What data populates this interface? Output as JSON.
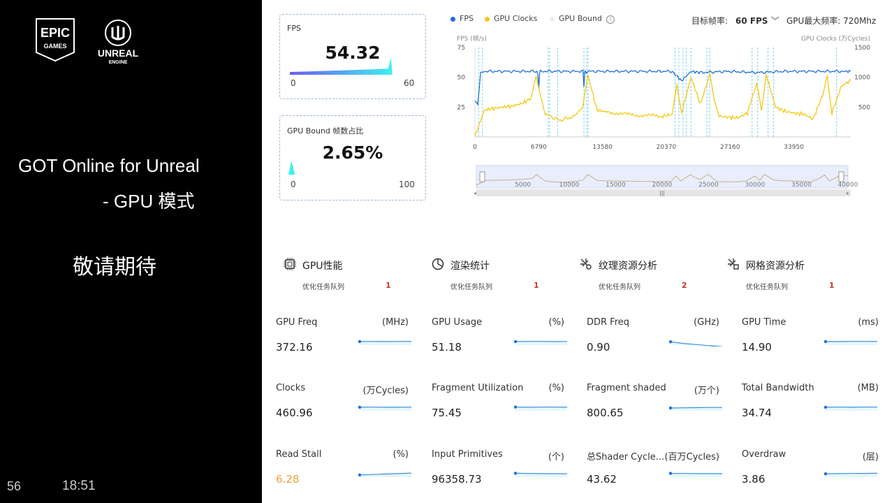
{
  "slide": {
    "title_line1": "GOT Online for Unreal",
    "title_line2": "- GPU 模式",
    "subtitle": "敬请期待",
    "slide_number": "56",
    "time": "18:51",
    "epic_logo_text": [
      "EPIC",
      "GAMES"
    ],
    "unreal_logo_text": [
      "UNREAL",
      "ENGINE"
    ]
  },
  "fps_card": {
    "label": "FPS",
    "value": "54.32",
    "min": "0",
    "max": "60",
    "fraction": 0.905
  },
  "gpu_bound_card": {
    "label": "GPU Bound 帧数占比",
    "value": "2.65%",
    "min": "0",
    "max": "100",
    "fraction": 0.0265
  },
  "chart_header": {
    "legend": [
      {
        "name": "FPS",
        "color": "#1f6fd6"
      },
      {
        "name": "GPU Clocks",
        "color": "#f2c811"
      },
      {
        "name": "GPU Bound",
        "color": "#eeeeee"
      }
    ],
    "info_icon": "info-circle-icon",
    "target_fps_label": "目标帧率:",
    "target_fps_value": "60 FPS",
    "max_freq_label": "GPU最大频率: 720Mhz"
  },
  "chart_data": {
    "type": "line",
    "y_left_label": "FPS (帧/s)",
    "y_right_label": "GPU Clocks (万Cycles)",
    "y_left_ticks": [
      "75",
      "50",
      "25"
    ],
    "y_right_ticks": [
      "1500",
      "1000",
      "500"
    ],
    "x_ticks": [
      "0",
      "6790",
      "13580",
      "20370",
      "27160",
      "33950"
    ],
    "ylim_left": [
      0,
      75
    ],
    "ylim_right": [
      0,
      1500
    ],
    "xlim": [
      0,
      40000
    ],
    "series": [
      {
        "name": "FPS",
        "color": "#1f6fd6",
        "axis": "left",
        "x": [
          0,
          300,
          600,
          900,
          1200,
          6600,
          6700,
          6800,
          6900,
          7000,
          11500,
          11600,
          11700,
          11800,
          11900,
          12000,
          21000,
          22000,
          23000,
          24000,
          27000,
          30000,
          33000,
          36000,
          39000,
          40000
        ],
        "y": [
          30,
          28,
          53,
          55,
          55,
          55,
          53,
          40,
          55,
          55,
          55,
          42,
          55,
          55,
          54,
          55,
          55,
          47,
          55,
          54,
          55,
          54,
          55,
          55,
          55,
          55
        ]
      },
      {
        "name": "GPU Clocks",
        "color": "#f2c811",
        "axis": "right",
        "x": [
          0,
          1000,
          2000,
          3000,
          4000,
          5000,
          6000,
          6500,
          7000,
          7500,
          9000,
          10500,
          11500,
          12000,
          13000,
          14000,
          16000,
          18000,
          20000,
          21000,
          21500,
          22000,
          23000,
          24000,
          25000,
          25500,
          26000,
          27000,
          28000,
          29000,
          30000,
          30500,
          31000,
          32000,
          33000,
          34000,
          35000,
          36000,
          37000,
          37500,
          38000,
          39000,
          40000
        ],
        "y": [
          0,
          450,
          480,
          500,
          520,
          560,
          650,
          1050,
          650,
          380,
          280,
          340,
          500,
          1050,
          450,
          420,
          380,
          360,
          350,
          380,
          900,
          400,
          1000,
          550,
          1050,
          600,
          350,
          330,
          320,
          400,
          900,
          450,
          1050,
          500,
          430,
          400,
          380,
          300,
          700,
          1000,
          400,
          850,
          950
        ]
      }
    ],
    "gpu_bound_x": [
      400,
      800,
      7800,
      7950,
      8800,
      11600,
      11900,
      12050,
      21300,
      21700,
      22150,
      22500,
      23000,
      24700,
      25000,
      29500,
      30100,
      31200,
      31800,
      38500
    ]
  },
  "slider": {
    "ticks": [
      "5000",
      "10000",
      "15000",
      "20000",
      "25000",
      "30000",
      "35000",
      "40000"
    ]
  },
  "categories": [
    {
      "name": "GPU性能",
      "icon": "gpu-chip-icon",
      "sub": "优化任务队列",
      "count": "1"
    },
    {
      "name": "渲染统计",
      "icon": "pie-chart-icon",
      "sub": "优化任务队列",
      "count": "1"
    },
    {
      "name": "纹理资源分析",
      "icon": "texture-analysis-icon",
      "sub": "优化任务队列",
      "count": "2"
    },
    {
      "name": "网格资源分析",
      "icon": "mesh-analysis-icon",
      "sub": "优化任务队列",
      "count": "1"
    }
  ],
  "metrics": [
    {
      "name": "GPU Freq",
      "unit": "(MHz)",
      "value": "372.16",
      "trend": [
        0.62,
        0.63,
        0.62,
        0.63,
        0.63
      ]
    },
    {
      "name": "GPU Usage",
      "unit": "(%)",
      "value": "51.18",
      "trend": [
        0.62,
        0.63,
        0.63,
        0.62,
        0.63
      ]
    },
    {
      "name": "DDR Freq",
      "unit": "(GHz)",
      "value": "0.90",
      "trend": [
        0.6,
        0.45,
        0.35,
        0.25,
        0.15
      ]
    },
    {
      "name": "GPU Time",
      "unit": "(ms)",
      "value": "14.90",
      "trend": [
        0.62,
        0.62,
        0.63,
        0.63,
        0.63
      ]
    },
    {
      "name": "Clocks",
      "unit": "(万Cycles)",
      "value": "460.96",
      "trend": [
        0.62,
        0.63,
        0.62,
        0.62,
        0.63
      ]
    },
    {
      "name": "Fragment Utilization",
      "unit": "(%)",
      "value": "75.45",
      "trend": [
        0.63,
        0.62,
        0.63,
        0.63,
        0.62
      ]
    },
    {
      "name": "Fragment shaded",
      "unit": "(万个)",
      "value": "800.65",
      "trend": [
        0.55,
        0.57,
        0.58,
        0.6,
        0.6
      ]
    },
    {
      "name": "Total Bandwidth",
      "unit": "(MB)",
      "value": "34.74",
      "trend": [
        0.62,
        0.63,
        0.62,
        0.63,
        0.63
      ]
    },
    {
      "name": "Read Stall",
      "unit": "(%)",
      "value": "6.28",
      "value_color": "#e8a23a",
      "trend": [
        0.5,
        0.54,
        0.58,
        0.62,
        0.66
      ]
    },
    {
      "name": "Input Primitives",
      "unit": "(个)",
      "value": "96358.73",
      "trend": [
        0.65,
        0.63,
        0.62,
        0.61,
        0.6
      ]
    },
    {
      "name": "总Shader Cycle...",
      "unit": "(百万Cycles)",
      "value": "43.62",
      "trend": [
        0.64,
        0.63,
        0.62,
        0.62,
        0.61
      ]
    },
    {
      "name": "Overdraw",
      "unit": "(层)",
      "value": "3.86",
      "trend": [
        0.6,
        0.62,
        0.63,
        0.64,
        0.65
      ]
    }
  ]
}
